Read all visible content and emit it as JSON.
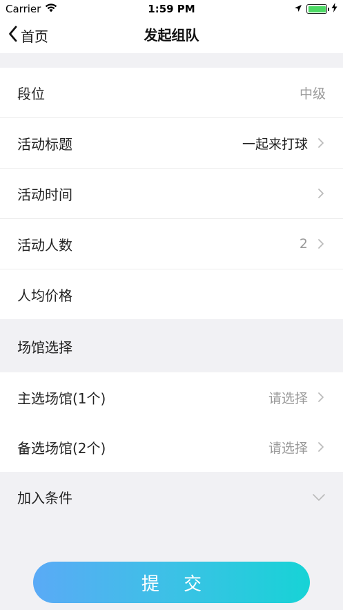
{
  "status_bar": {
    "carrier": "Carrier",
    "time": "1:59 PM"
  },
  "nav": {
    "back_label": "首页",
    "title": "发起组队"
  },
  "form": {
    "rank": {
      "label": "段位",
      "value": "中级"
    },
    "title": {
      "label": "活动标题",
      "value": "一起来打球"
    },
    "time": {
      "label": "活动时间",
      "value": ""
    },
    "count": {
      "label": "活动人数",
      "value": "2"
    },
    "price": {
      "label": "人均价格"
    }
  },
  "venue_section": {
    "label": "场馆选择",
    "primary": {
      "label": "主选场馆(1个)",
      "value": "请选择"
    },
    "backup": {
      "label": "备选场馆(2个)",
      "value": "请选择"
    }
  },
  "conditions": {
    "label": "加入条件"
  },
  "submit_label": "提 交"
}
